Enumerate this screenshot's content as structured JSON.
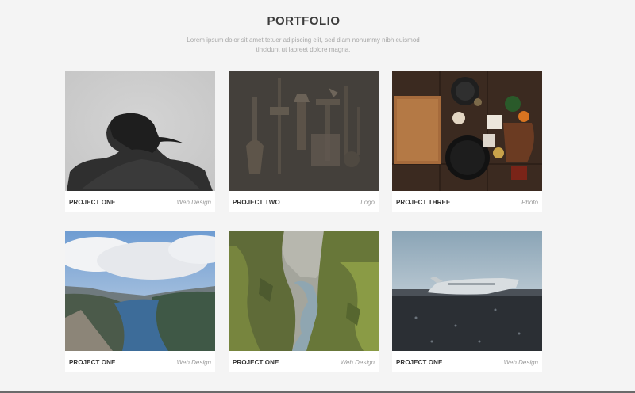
{
  "header": {
    "title": "PORTFOLIO",
    "subtitle": "Lorem ipsum dolor sit amet tetuer adipiscing elit, sed diam nonummy nibh euismod tincidunt ut laoreet dolore magna."
  },
  "projects": [
    {
      "title": "PROJECT ONE",
      "category": "Web Design",
      "image": "woman-back-grayscale"
    },
    {
      "title": "PROJECT TWO",
      "category": "Logo",
      "image": "hanging-tools"
    },
    {
      "title": "PROJECT THREE",
      "category": "Photo",
      "image": "kitchen-table-flatlay"
    },
    {
      "title": "PROJECT ONE",
      "category": "Web Design",
      "image": "fjord-landscape"
    },
    {
      "title": "PROJECT ONE",
      "category": "Web Design",
      "image": "mossy-canyon"
    },
    {
      "title": "PROJECT ONE",
      "category": "Web Design",
      "image": "plane-wreck-beach"
    }
  ]
}
